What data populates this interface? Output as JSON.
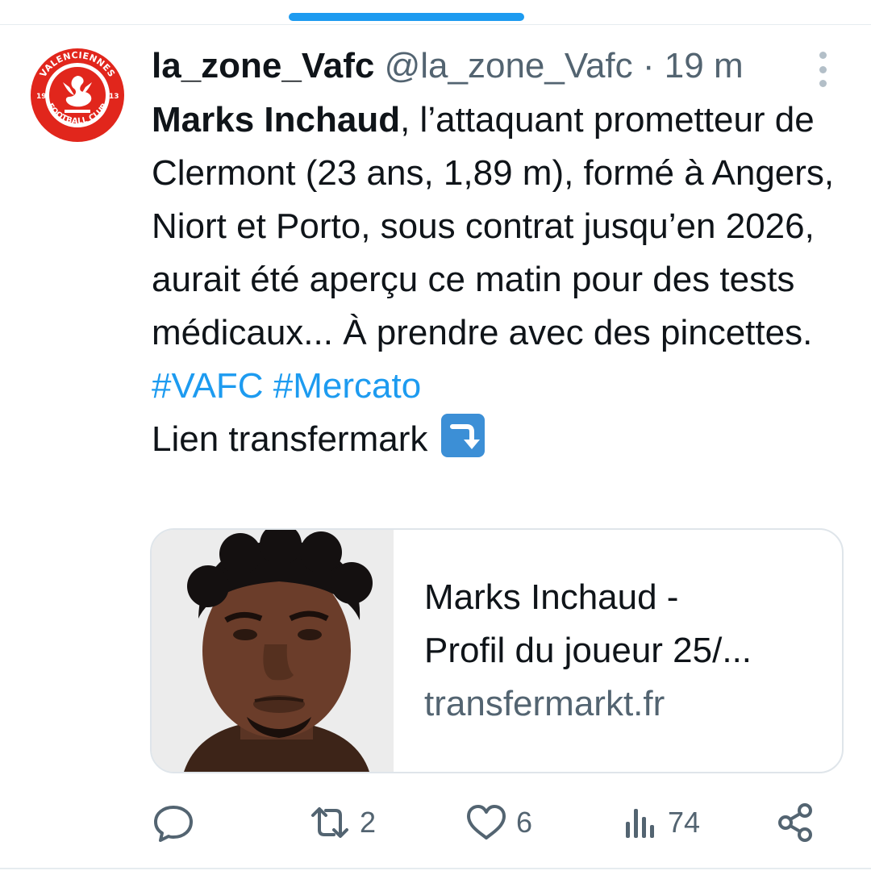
{
  "header": {
    "display_name": "la_zone_Vafc",
    "handle": "@la_zone_Vafc",
    "separator": "·",
    "time": "19 m"
  },
  "avatar": {
    "ring_top_text": "VALENCIENNES",
    "ring_bottom_text": "FOOTBALL CLUB",
    "year_left": "19",
    "year_right": "13",
    "colors": {
      "primary": "#e1261c",
      "secondary": "#ffffff"
    }
  },
  "tweet": {
    "bold_name": "Marks Inchaud",
    "text_main": ", l’attaquant prometteur de Clermont (23 ans, 1,89 m), formé à Angers, Niort et Porto, sous contrat jusqu’en 2026, aurait été aperçu ce matin pour des tests médicaux... À prendre avec des pincettes.",
    "hashtag_1": "#VAFC",
    "hashtag_2": "#Mercato",
    "link_line": "Lien transfermark",
    "emoji": "right-arrow-curving-down-icon"
  },
  "link_card": {
    "title_line_1": "Marks Inchaud -",
    "title_line_2": "Profil du joueur 25/...",
    "domain": "transfermarkt.fr"
  },
  "actions": {
    "reply_count": "",
    "retweet_count": "2",
    "like_count": "6",
    "views_count": "74"
  },
  "colors": {
    "accent": "#1d9bf0",
    "muted": "#536471",
    "text": "#0f1419"
  }
}
